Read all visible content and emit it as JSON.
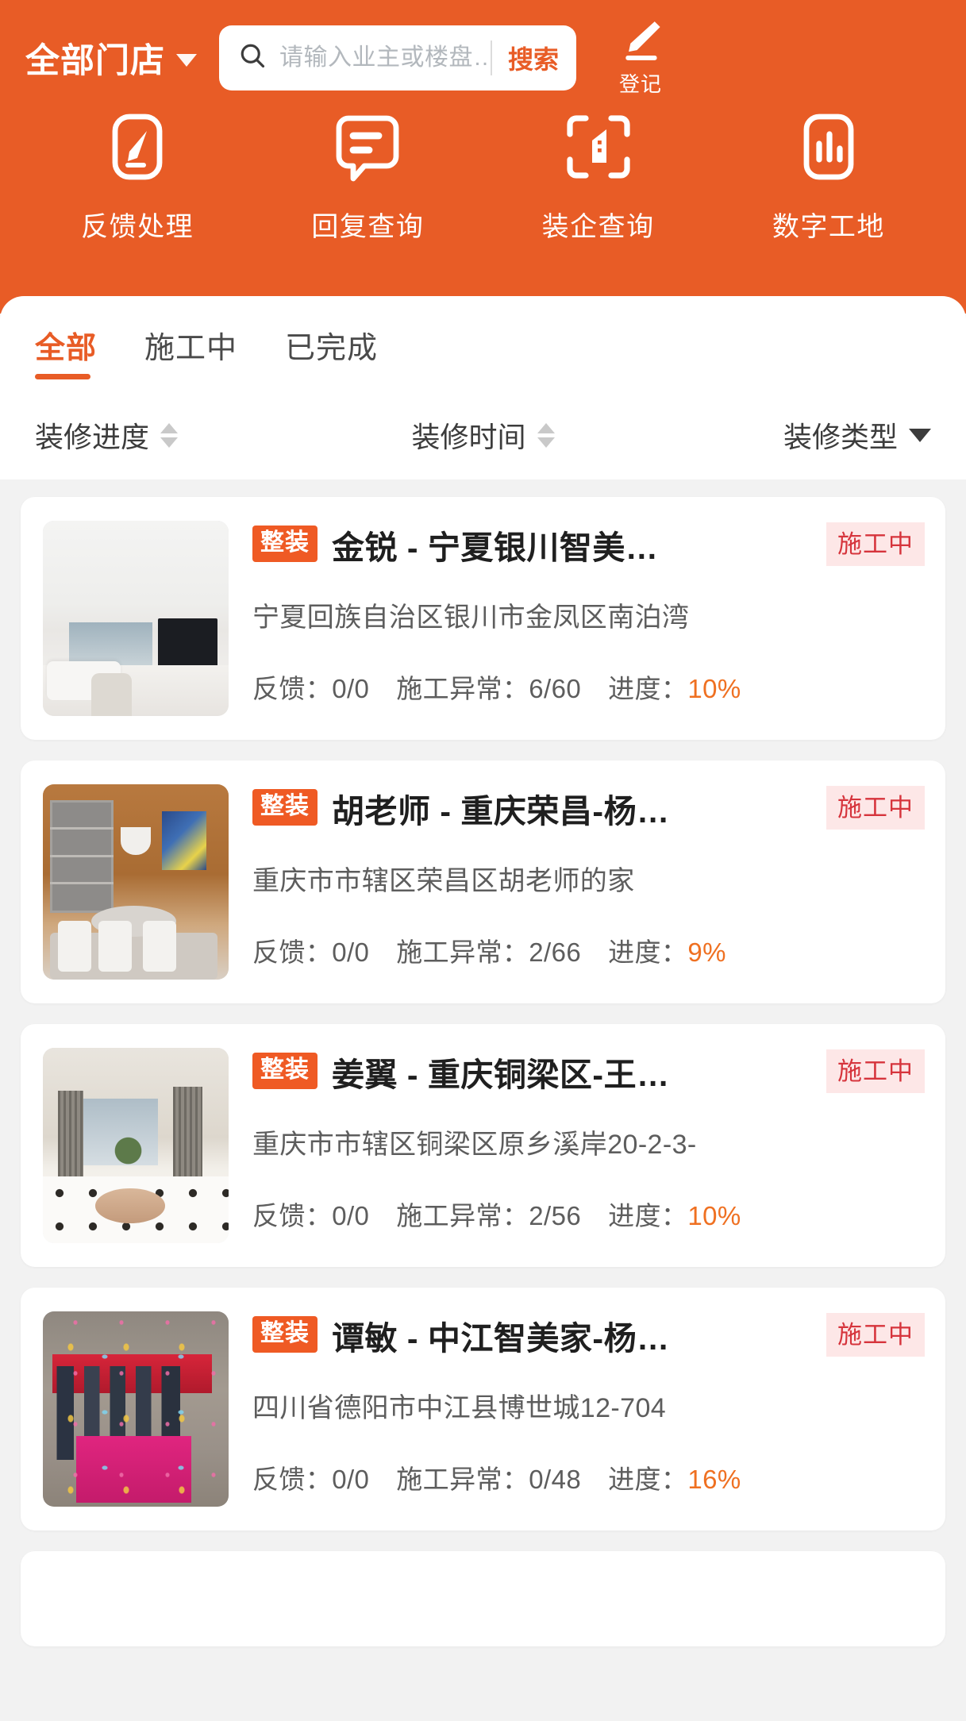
{
  "theme": {
    "brand_orange": "#e85c26",
    "badge_orange": "#ef5a24",
    "accent_progress": "#ef7021",
    "status_bg": "#fde7e7",
    "status_text": "#d6343c"
  },
  "header": {
    "store_selector": {
      "label": "全部门店",
      "icon": "chevron-down-icon"
    },
    "search": {
      "icon": "search-icon",
      "placeholder": "请输入业主或楼盘…",
      "value": "",
      "button_label": "搜索"
    },
    "register": {
      "icon": "pencil-register-icon",
      "label": "登记"
    }
  },
  "quick_actions": [
    {
      "label": "反馈处理",
      "icon": "feedback-edit-icon"
    },
    {
      "label": "回复查询",
      "icon": "reply-chat-icon"
    },
    {
      "label": "装企查询",
      "icon": "scan-building-icon"
    },
    {
      "label": "数字工地",
      "icon": "bar-chart-site-icon"
    }
  ],
  "tabs": [
    {
      "label": "全部",
      "active": true
    },
    {
      "label": "施工中",
      "active": false
    },
    {
      "label": "已完成",
      "active": false
    }
  ],
  "filters": [
    {
      "label": "装修进度",
      "control": "sort-arrows-icon"
    },
    {
      "label": "装修时间",
      "control": "sort-arrows-icon"
    },
    {
      "label": "装修类型",
      "control": "chevron-down-icon"
    }
  ],
  "list_labels": {
    "feedback": "反馈：",
    "exception": "施工异常：",
    "progress": "进度："
  },
  "cards": [
    {
      "type_badge": "整装",
      "title": "金锐 - 宁夏银川智美…",
      "status": "施工中",
      "address": "宁夏回族自治区银川市金凤区南泊湾",
      "feedback_value": "0/0",
      "exception_value": "6/60",
      "progress_value": "10%",
      "thumb_class": "art1"
    },
    {
      "type_badge": "整装",
      "title": "胡老师 - 重庆荣昌-杨…",
      "status": "施工中",
      "address": "重庆市市辖区荣昌区胡老师的家",
      "feedback_value": "0/0",
      "exception_value": "2/66",
      "progress_value": "9%",
      "thumb_class": "art2"
    },
    {
      "type_badge": "整装",
      "title": "姜翼 - 重庆铜梁区-王…",
      "status": "施工中",
      "address": "重庆市市辖区铜梁区原乡溪岸20-2-3-",
      "feedback_value": "0/0",
      "exception_value": "2/56",
      "progress_value": "10%",
      "thumb_class": "art3"
    },
    {
      "type_badge": "整装",
      "title": "谭敏 - 中江智美家-杨…",
      "status": "施工中",
      "address": "四川省德阳市中江县博世城12-704",
      "feedback_value": "0/0",
      "exception_value": "0/48",
      "progress_value": "16%",
      "thumb_class": "art4"
    }
  ]
}
